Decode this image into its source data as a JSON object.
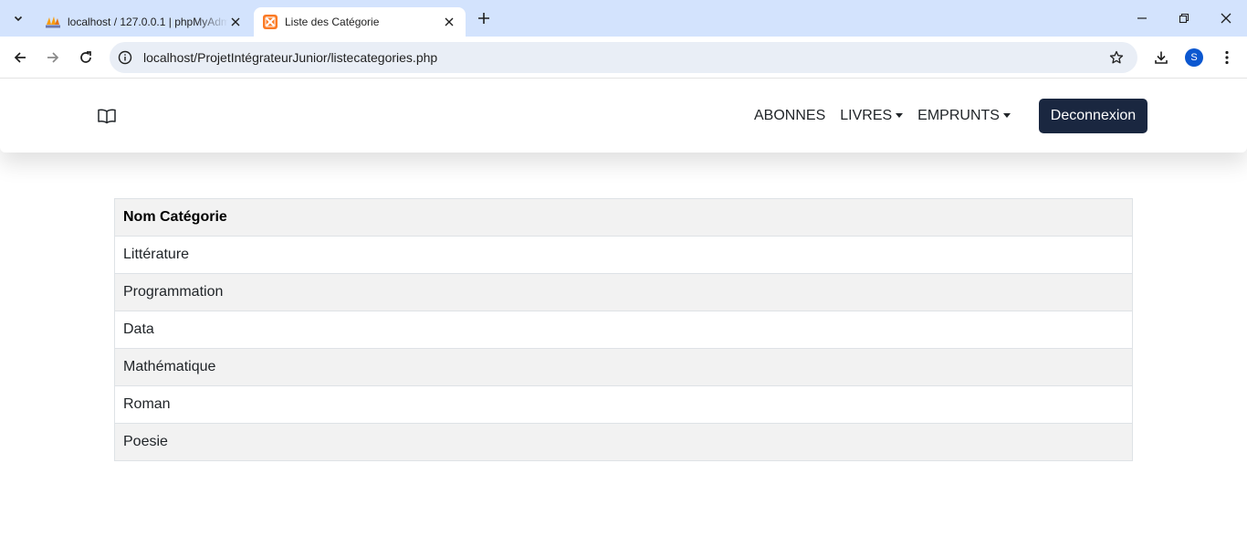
{
  "browser": {
    "tabs": [
      {
        "title": "localhost / 127.0.0.1 | phpMyAdmin",
        "favicon": "phpmyadmin-icon",
        "active": false
      },
      {
        "title": "Liste des Catégorie",
        "favicon": "xampp-icon",
        "active": true
      }
    ],
    "url": "localhost/ProjetIntégrateurJunior/listecategories.php",
    "profile_initial": "S"
  },
  "navbar": {
    "brand_icon": "open-book-icon",
    "links": [
      {
        "label": "ABONNES",
        "dropdown": false
      },
      {
        "label": "LIVRES",
        "dropdown": true
      },
      {
        "label": "EMPRUNTS",
        "dropdown": true
      }
    ],
    "logout_label": "Deconnexion",
    "logout_color": "#1a2740"
  },
  "table": {
    "header": "Nom Catégorie",
    "rows": [
      "Littérature",
      "Programmation",
      "Data",
      "Mathématique",
      "Roman",
      "Poesie"
    ]
  }
}
